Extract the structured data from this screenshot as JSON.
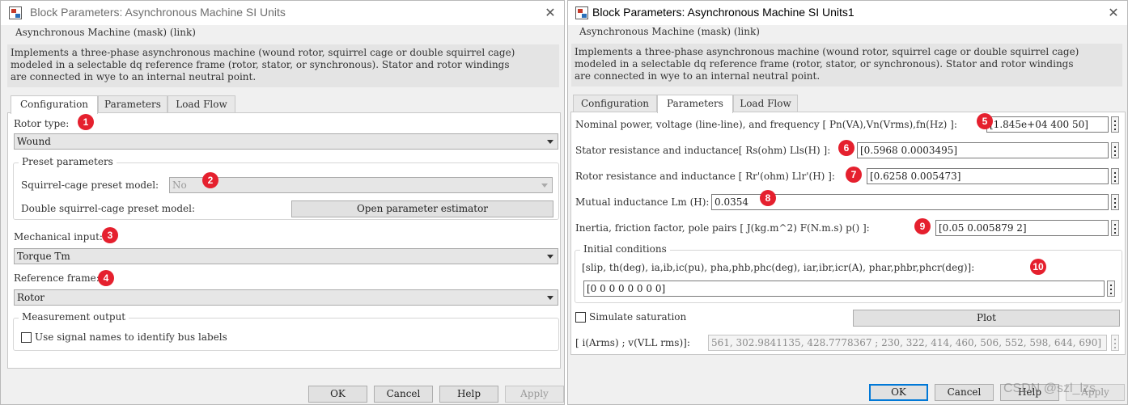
{
  "left_dialog": {
    "title": "Block Parameters: Asynchronous Machine SI Units",
    "close_glyph": "✕",
    "mask_legend": "Asynchronous Machine (mask) (link)",
    "description": "Implements a three-phase asynchronous machine (wound rotor, squirrel cage or double squirrel cage)\nmodeled in a selectable dq reference frame (rotor, stator, or synchronous). Stator and rotor windings\nare connected in wye to an internal neutral point.",
    "tabs": [
      "Configuration",
      "Parameters",
      "Load Flow"
    ],
    "active_tab": "Configuration",
    "rotor_type_label": "Rotor type:",
    "rotor_type_value": "Wound",
    "preset_legend": "Preset parameters",
    "squirrel_preset_label": "Squirrel-cage preset model:",
    "squirrel_preset_value": "No",
    "double_squirrel_label": "Double squirrel-cage preset model:",
    "open_estimator_label": "Open parameter estimator",
    "mechanical_input_label": "Mechanical input:",
    "mechanical_input_value": "Torque Tm",
    "reference_frame_label": "Reference frame:",
    "reference_frame_value": "Rotor",
    "measurement_legend": "Measurement output",
    "signal_names_label": "Use signal names to identify bus labels",
    "buttons": {
      "ok": "OK",
      "cancel": "Cancel",
      "help": "Help",
      "apply": "Apply"
    }
  },
  "right_dialog": {
    "title": "Block Parameters: Asynchronous Machine SI Units1",
    "close_glyph": "✕",
    "mask_legend": "Asynchronous Machine (mask) (link)",
    "description": "Implements a three-phase asynchronous machine (wound rotor, squirrel cage or double squirrel cage)\nmodeled in a selectable dq reference frame (rotor, stator, or synchronous). Stator and rotor windings\nare connected in wye to an internal neutral point.",
    "tabs": [
      "Configuration",
      "Parameters",
      "Load Flow"
    ],
    "active_tab": "Parameters",
    "params": [
      {
        "label": "Nominal power, voltage (line-line), and frequency [ Pn(VA),Vn(Vrms),fn(Hz) ]:",
        "value": "[1.845e+04 400 50]"
      },
      {
        "label": "Stator resistance and inductance[ Rs(ohm)  Lls(H) ]:",
        "value": "[0.5968 0.0003495]"
      },
      {
        "label": "Rotor resistance and inductance [ Rr'(ohm)  Llr'(H) ]:",
        "value": "[0.6258 0.005473]"
      },
      {
        "label": "Mutual inductance Lm (H):",
        "value": "0.0354"
      },
      {
        "label": "Inertia, friction factor, pole pairs [ J(kg.m^2)  F(N.m.s)   p() ]:",
        "value": "[0.05 0.005879 2]"
      }
    ],
    "initial_legend": "Initial conditions",
    "initial_label": "[slip, th(deg), ia,ib,ic(pu), pha,phb,phc(deg), iar,ibr,icr(A), phar,phbr,phcr(deg)]:",
    "initial_value": "[0 0 0 0 0 0 0 0]",
    "simulate_saturation_label": "Simulate saturation",
    "plot_label": "Plot",
    "saturation_label": "[ i(Arms) ; v(VLL rms)]:",
    "saturation_value": "561, 302.9841135, 428.7778367 ; 230, 322, 414, 460, 506, 552, 598, 644, 690]",
    "buttons": {
      "ok": "OK",
      "cancel": "Cancel",
      "help": "Help",
      "apply": "Apply"
    }
  },
  "annotations": [
    "1",
    "2",
    "3",
    "4",
    "5",
    "6",
    "7",
    "8",
    "9",
    "10"
  ],
  "watermark": "CSDN @szl_lzs",
  "colors": {
    "badge": "#e5202e",
    "default_button_border": "#0078d7",
    "description_bg": "#e4e4e4"
  }
}
